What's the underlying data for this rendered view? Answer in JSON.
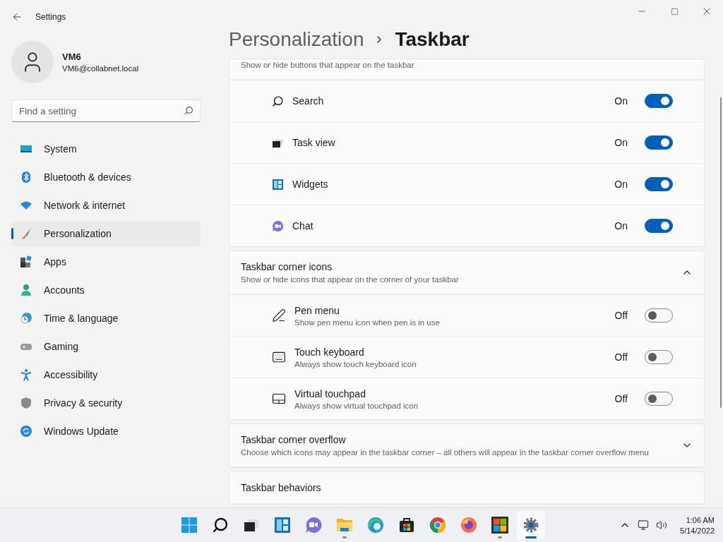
{
  "window": {
    "title": "Settings"
  },
  "profile": {
    "name": "VM6",
    "email": "VM6@collabnet.local"
  },
  "search": {
    "placeholder": "Find a setting"
  },
  "nav": [
    {
      "kind": "system",
      "label": "System",
      "selected": false
    },
    {
      "kind": "bluetooth",
      "label": "Bluetooth & devices",
      "selected": false
    },
    {
      "kind": "network",
      "label": "Network & internet",
      "selected": false
    },
    {
      "kind": "brush",
      "label": "Personalization",
      "selected": true
    },
    {
      "kind": "apps",
      "label": "Apps",
      "selected": false
    },
    {
      "kind": "accounts",
      "label": "Accounts",
      "selected": false
    },
    {
      "kind": "time",
      "label": "Time & language",
      "selected": false
    },
    {
      "kind": "gaming",
      "label": "Gaming",
      "selected": false
    },
    {
      "kind": "accessibility",
      "label": "Accessibility",
      "selected": false
    },
    {
      "kind": "privacy",
      "label": "Privacy & security",
      "selected": false
    },
    {
      "kind": "update",
      "label": "Windows Update",
      "selected": false
    }
  ],
  "breadcrumb": {
    "parent": "Personalization",
    "current": "Taskbar"
  },
  "sections": [
    {
      "subtitle": "Show or hide buttons that appear on the taskbar",
      "items": [
        {
          "kind": "search",
          "label": "Search",
          "state_label": "On",
          "on": true
        },
        {
          "kind": "taskview",
          "label": "Task view",
          "state_label": "On",
          "on": true
        },
        {
          "kind": "widgets",
          "label": "Widgets",
          "state_label": "On",
          "on": true
        },
        {
          "kind": "chat",
          "label": "Chat",
          "state_label": "On",
          "on": true
        }
      ]
    },
    {
      "title": "Taskbar corner icons",
      "subtitle": "Show or hide icons that appear on the corner of your taskbar",
      "expanded": true,
      "items": [
        {
          "kind": "pen",
          "label": "Pen menu",
          "description": "Show pen menu icon when pen is in use",
          "state_label": "Off",
          "on": false
        },
        {
          "kind": "keyboard",
          "label": "Touch keyboard",
          "description": "Always show touch keyboard icon",
          "state_label": "Off",
          "on": false
        },
        {
          "kind": "touchpad",
          "label": "Virtual touchpad",
          "description": "Always show virtual touchpad icon",
          "state_label": "Off",
          "on": false
        }
      ]
    },
    {
      "title": "Taskbar corner overflow",
      "subtitle": "Choose which icons may appear in the taskbar corner – all others will appear in the taskbar corner overflow menu",
      "expanded": false
    },
    {
      "title": "Taskbar behaviors"
    }
  ],
  "taskbar": {
    "apps": [
      {
        "kind": "start",
        "running": false,
        "active": false
      },
      {
        "kind": "search",
        "running": false,
        "active": false
      },
      {
        "kind": "taskview",
        "running": false,
        "active": false
      },
      {
        "kind": "widgets",
        "running": false,
        "active": false
      },
      {
        "kind": "chat",
        "running": false,
        "active": false
      },
      {
        "kind": "explorer",
        "running": true,
        "active": false
      },
      {
        "kind": "edge",
        "running": false,
        "active": false
      },
      {
        "kind": "store",
        "running": false,
        "active": false
      },
      {
        "kind": "chrome",
        "running": false,
        "active": false
      },
      {
        "kind": "firefox",
        "running": false,
        "active": false
      },
      {
        "kind": "msapp",
        "running": true,
        "active": false
      },
      {
        "kind": "settings",
        "running": true,
        "active": true
      }
    ],
    "time": "1:06 AM",
    "date": "5/14/2022"
  }
}
